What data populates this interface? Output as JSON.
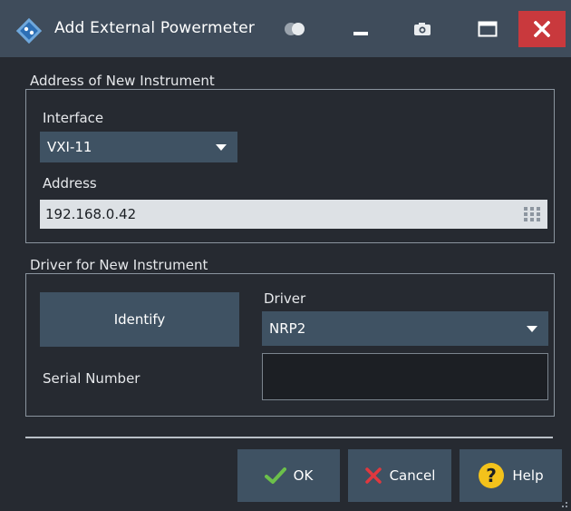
{
  "window": {
    "title": "Add External Powermeter"
  },
  "address_group": {
    "title": "Address of New Instrument",
    "interface_label": "Interface",
    "interface_value": "VXI-11",
    "address_label": "Address",
    "address_value": "192.168.0.42"
  },
  "driver_group": {
    "title": "Driver for New Instrument",
    "identify_label": "Identify",
    "driver_label": "Driver",
    "driver_value": "NRP2",
    "serial_label": "Serial Number",
    "serial_value": ""
  },
  "buttons": {
    "ok": "OK",
    "cancel": "Cancel",
    "help": "Help"
  },
  "colors": {
    "titlebar": "#3f4c5b",
    "background": "#262a31",
    "control": "#3f5263",
    "close": "#c9393d",
    "ok_check": "#6cc04a",
    "cancel_x": "#e0383e",
    "help_circle": "#f3c21b"
  },
  "icons": {
    "app": "rs-logo-icon",
    "toggle": "toggle-icon",
    "minimize": "minimize-icon",
    "screenshot": "camera-icon",
    "maximize": "maximize-icon",
    "close": "close-icon",
    "keypad": "keypad-icon",
    "ok": "check-icon",
    "cancel": "x-icon",
    "help": "question-icon"
  }
}
